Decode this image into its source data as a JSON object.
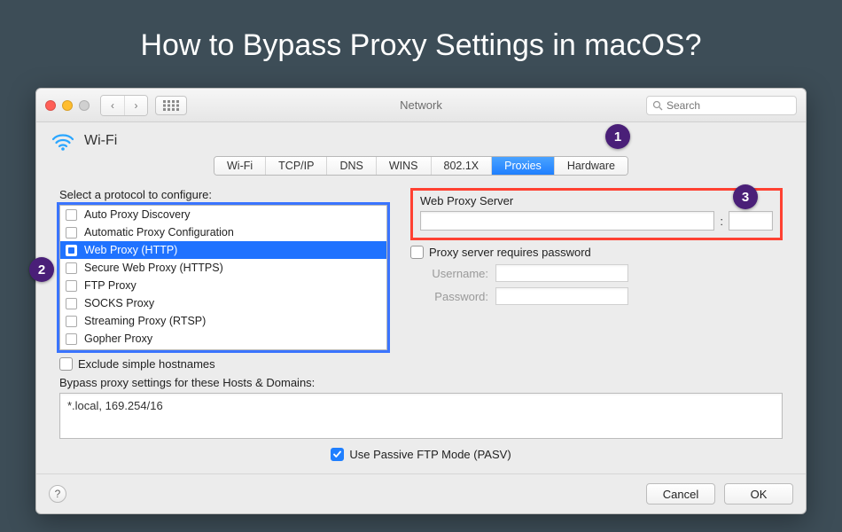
{
  "page": {
    "title": "How to Bypass Proxy Settings in macOS?"
  },
  "titlebar": {
    "title": "Network",
    "search_placeholder": "Search"
  },
  "wifi": {
    "label": "Wi-Fi"
  },
  "tabs": [
    {
      "label": "Wi-Fi",
      "active": false
    },
    {
      "label": "TCP/IP",
      "active": false
    },
    {
      "label": "DNS",
      "active": false
    },
    {
      "label": "WINS",
      "active": false
    },
    {
      "label": "802.1X",
      "active": false
    },
    {
      "label": "Proxies",
      "active": true
    },
    {
      "label": "Hardware",
      "active": false
    }
  ],
  "callouts": {
    "one": "1",
    "two": "2",
    "three": "3"
  },
  "protocols": {
    "label": "Select a protocol to configure:",
    "items": [
      {
        "label": "Auto Proxy Discovery",
        "checked": false,
        "selected": false
      },
      {
        "label": "Automatic Proxy Configuration",
        "checked": false,
        "selected": false
      },
      {
        "label": "Web Proxy (HTTP)",
        "checked": true,
        "selected": true
      },
      {
        "label": "Secure Web Proxy (HTTPS)",
        "checked": false,
        "selected": false
      },
      {
        "label": "FTP Proxy",
        "checked": false,
        "selected": false
      },
      {
        "label": "SOCKS Proxy",
        "checked": false,
        "selected": false
      },
      {
        "label": "Streaming Proxy (RTSP)",
        "checked": false,
        "selected": false
      },
      {
        "label": "Gopher Proxy",
        "checked": false,
        "selected": false
      }
    ]
  },
  "webproxy": {
    "title": "Web Proxy Server",
    "host": "",
    "port": "",
    "colon": ":",
    "requires_password_label": "Proxy server requires password",
    "requires_password_checked": false,
    "username_label": "Username:",
    "password_label": "Password:",
    "username": "",
    "password": ""
  },
  "exclude": {
    "label": "Exclude simple hostnames",
    "checked": false
  },
  "bypass": {
    "label": "Bypass proxy settings for these Hosts & Domains:",
    "value": "*.local, 169.254/16"
  },
  "pasv": {
    "label": "Use Passive FTP Mode (PASV)",
    "checked": true
  },
  "footer": {
    "help": "?",
    "cancel": "Cancel",
    "ok": "OK"
  }
}
